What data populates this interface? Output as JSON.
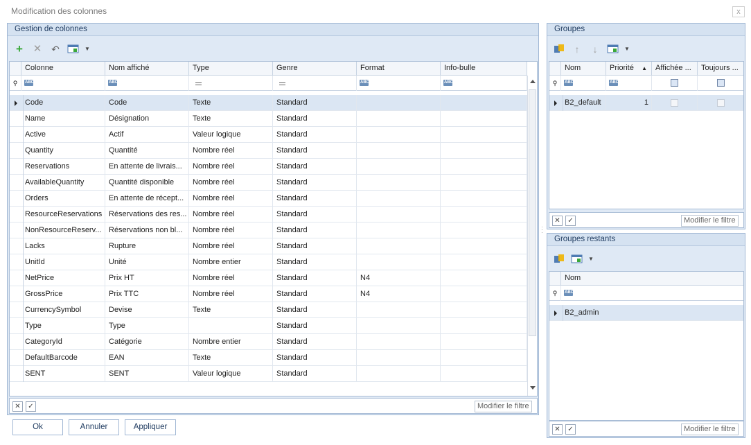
{
  "window": {
    "title": "Modification des colonnes",
    "close_glyph": "x"
  },
  "left_panel": {
    "title": "Gestion de colonnes",
    "toolbar_icons": [
      "add-icon",
      "delete-icon",
      "undo-icon",
      "columns-view-icon",
      "chevron-down-icon"
    ],
    "columns": [
      "Colonne",
      "Nom affiché",
      "Type",
      "Genre",
      "Format",
      "Info-bulle"
    ],
    "rows": [
      {
        "colonne": "Code",
        "nom": "Code",
        "type": "Texte",
        "genre": "Standard",
        "format": "",
        "info": ""
      },
      {
        "colonne": "Name",
        "nom": "Désignation",
        "type": "Texte",
        "genre": "Standard",
        "format": "",
        "info": ""
      },
      {
        "colonne": "Active",
        "nom": "Actif",
        "type": "Valeur logique",
        "genre": "Standard",
        "format": "",
        "info": ""
      },
      {
        "colonne": "Quantity",
        "nom": "Quantité",
        "type": "Nombre réel",
        "genre": "Standard",
        "format": "",
        "info": ""
      },
      {
        "colonne": "Reservations",
        "nom": "En attente de livrais...",
        "type": "Nombre réel",
        "genre": "Standard",
        "format": "",
        "info": ""
      },
      {
        "colonne": "AvailableQuantity",
        "nom": "Quantité disponible",
        "type": "Nombre réel",
        "genre": "Standard",
        "format": "",
        "info": ""
      },
      {
        "colonne": "Orders",
        "nom": "En attente de récept...",
        "type": "Nombre réel",
        "genre": "Standard",
        "format": "",
        "info": ""
      },
      {
        "colonne": "ResourceReservations",
        "nom": "Réservations des res...",
        "type": "Nombre réel",
        "genre": "Standard",
        "format": "",
        "info": ""
      },
      {
        "colonne": "NonResourceReserv...",
        "nom": "Réservations non bl...",
        "type": "Nombre réel",
        "genre": "Standard",
        "format": "",
        "info": ""
      },
      {
        "colonne": "Lacks",
        "nom": "Rupture",
        "type": "Nombre réel",
        "genre": "Standard",
        "format": "",
        "info": ""
      },
      {
        "colonne": "UnitId",
        "nom": "Unité",
        "type": "Nombre entier",
        "genre": "Standard",
        "format": "",
        "info": ""
      },
      {
        "colonne": "NetPrice",
        "nom": "Prix HT",
        "type": "Nombre réel",
        "genre": "Standard",
        "format": "N4",
        "info": ""
      },
      {
        "colonne": "GrossPrice",
        "nom": "Prix TTC",
        "type": "Nombre réel",
        "genre": "Standard",
        "format": "N4",
        "info": ""
      },
      {
        "colonne": "CurrencySymbol",
        "nom": "Devise",
        "type": "Texte",
        "genre": "Standard",
        "format": "",
        "info": ""
      },
      {
        "colonne": "Type",
        "nom": "Type",
        "type": "",
        "genre": "Standard",
        "format": "",
        "info": ""
      },
      {
        "colonne": "CategoryId",
        "nom": "Catégorie",
        "type": "Nombre entier",
        "genre": "Standard",
        "format": "",
        "info": ""
      },
      {
        "colonne": "DefaultBarcode",
        "nom": "EAN",
        "type": "Texte",
        "genre": "Standard",
        "format": "",
        "info": ""
      },
      {
        "colonne": "SENT",
        "nom": "SENT",
        "type": "Valeur logique",
        "genre": "Standard",
        "format": "",
        "info": ""
      }
    ],
    "filter_button": "Modifier le filtre"
  },
  "groups_panel": {
    "title": "Groupes",
    "columns": [
      "Nom",
      "Priorité",
      "Affichée ...",
      "Toujours ..."
    ],
    "rows": [
      {
        "nom": "B2_default",
        "priorite": "1"
      }
    ],
    "filter_button": "Modifier le filtre"
  },
  "remaining_panel": {
    "title": "Groupes restants",
    "columns": [
      "Nom"
    ],
    "rows": [
      {
        "nom": "B2_admin"
      }
    ],
    "filter_button": "Modifier le filtre"
  },
  "buttons": {
    "ok": "Ok",
    "cancel": "Annuler",
    "apply": "Appliquer"
  },
  "filter_abc": "ABC",
  "colors": {
    "panel_bg": "#dfe9f5",
    "border": "#9fb6d3",
    "selected_row": "#dbe6f3",
    "accent_green": "#3aa83a"
  }
}
